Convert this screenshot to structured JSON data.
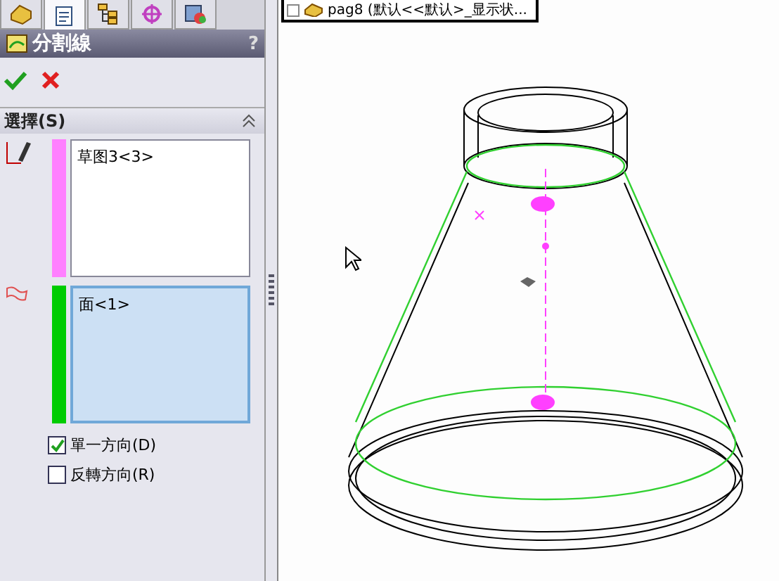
{
  "panel_tabs": [
    {
      "selected": false
    },
    {
      "selected": true
    },
    {
      "selected": false
    },
    {
      "selected": false
    },
    {
      "selected": false
    }
  ],
  "title_bar": {
    "title": "分割線",
    "help": "?"
  },
  "section": {
    "title": "選擇(S)",
    "expanded": true
  },
  "selection_lists": [
    {
      "kind": "sketch",
      "color": "#ff80ff",
      "items": [
        "草图3<3>"
      ],
      "selected": false
    },
    {
      "kind": "face",
      "color": "#00cc00",
      "items": [
        "面<1>"
      ],
      "selected": true
    }
  ],
  "options": [
    {
      "label": "單一方向(D)",
      "checked": true
    },
    {
      "label": "反轉方向(R)",
      "checked": false
    }
  ],
  "tree_item": {
    "label": "pag8 (默认<<默认>_显示状..."
  }
}
